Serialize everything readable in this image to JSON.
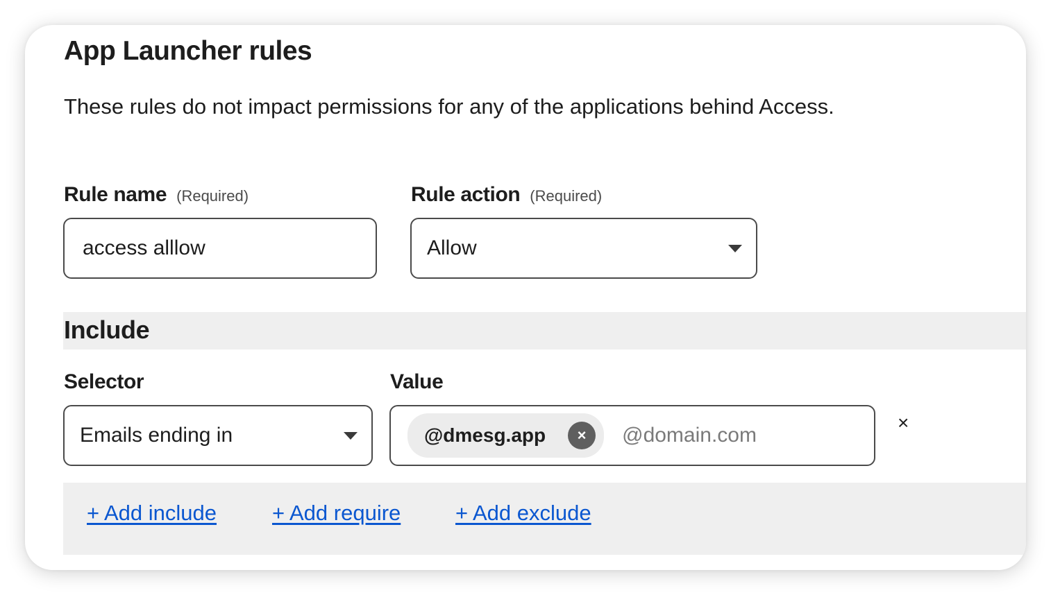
{
  "panel": {
    "title": "App Launcher rules",
    "description": "These rules do not impact permissions for any of the applications behind Access."
  },
  "rule_name": {
    "label": "Rule name",
    "required_note": "(Required)",
    "value": "access alllow"
  },
  "rule_action": {
    "label": "Rule action",
    "required_note": "(Required)",
    "selected": "Allow"
  },
  "include": {
    "title": "Include",
    "selector_label": "Selector",
    "value_label": "Value",
    "selector_selected": "Emails ending in",
    "chips": [
      "@dmesg.app"
    ],
    "value_placeholder": "@domain.com",
    "chip_remove_glyph": "×",
    "row_remove_glyph": "×"
  },
  "actions": {
    "add_include": "+ Add include",
    "add_require": "+ Add require",
    "add_exclude": "+ Add exclude"
  },
  "colors": {
    "link": "#0b57d0",
    "band": "#efefef",
    "chip": "#ececec",
    "chip_remove": "#5f5f5f"
  },
  "icons": {
    "dropdown": "triangle-down-icon",
    "chip_remove": "close-circle-icon",
    "row_remove": "close-icon"
  }
}
